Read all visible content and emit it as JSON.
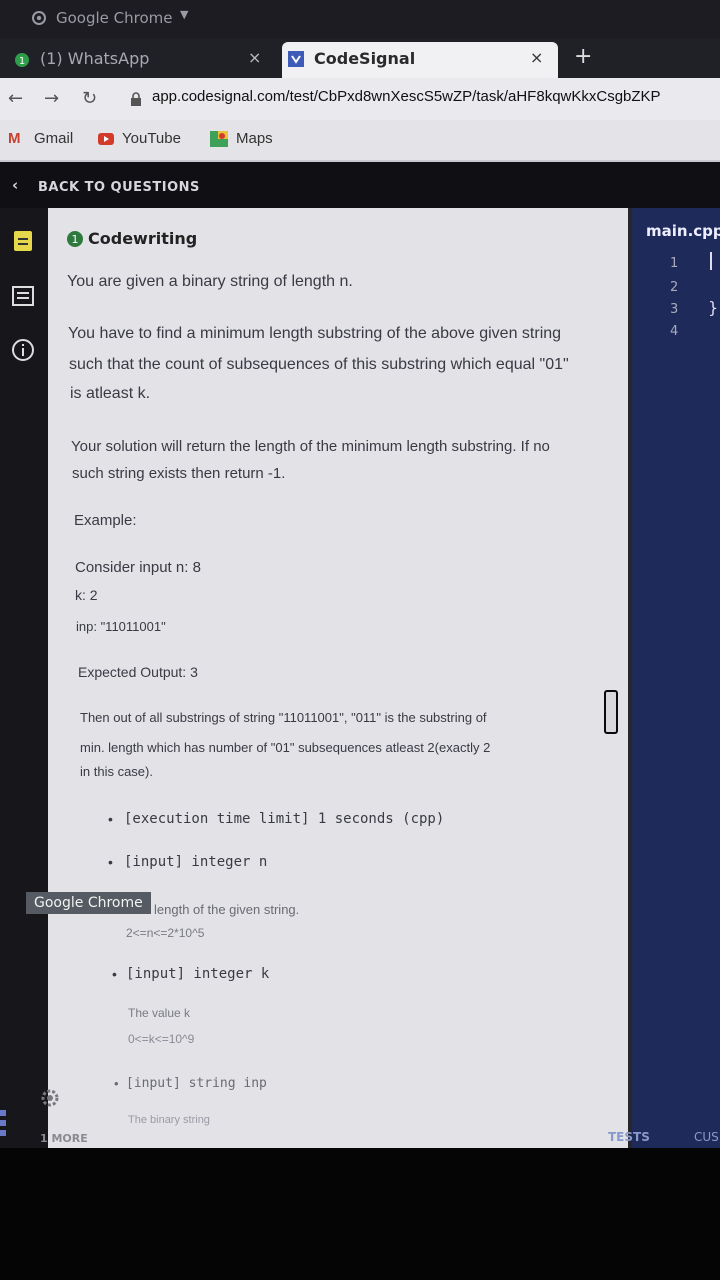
{
  "browser": {
    "window_title": "Google Chrome",
    "tabs": [
      {
        "label": "(1) WhatsApp",
        "close": "×"
      },
      {
        "label": "CodeSignal",
        "close": "×"
      }
    ],
    "new_tab": "+",
    "url": "app.codesignal.com/test/CbPxd8wnXescS5wZP/task/aHF8kqwKkxCsgbZKP",
    "bookmarks": [
      "Gmail",
      "YouTube",
      "Maps"
    ]
  },
  "app": {
    "back_label": "BACK TO QUESTIONS",
    "section_title": "Codewriting",
    "description": [
      "You are given a binary string of length n.",
      "You have to find a minimum length substring of the above given string",
      "such that the count of subsequences of this substring which equal \"01\"",
      "is atleast k.",
      "Your solution will return the length of the minimum length substring. If no",
      "such string exists then return -1."
    ],
    "example_label": "Example:",
    "example_lines": [
      "Consider input n: 8",
      "k: 2",
      "inp: \"11011001\""
    ],
    "expected_output": "Expected Output: 3",
    "explanation": [
      "Then out of all substrings of string \"11011001\", \"011\" is the substring of",
      "min. length which has number of \"01\" subsequences atleast 2(exactly 2",
      "in this case)."
    ],
    "constraints": [
      {
        "label": "[execution time limit] 1 seconds (cpp)"
      },
      {
        "label": "[input] integer n",
        "desc": "length of the given string.",
        "range": "2<=n<=2*10^5"
      },
      {
        "label": "[input] integer k",
        "desc": "The value k",
        "range": "0<=k<=10^9"
      },
      {
        "label": "[input] string inp",
        "desc": "The binary string"
      }
    ],
    "more_label": "1 MORE",
    "tooltip": "Google Chrome",
    "editor": {
      "filename": "main.cpp",
      "line_numbers": [
        "1",
        "2",
        "3",
        "4"
      ],
      "brace": "}",
      "tests_label": "TESTS",
      "custom_label": "CUS"
    }
  },
  "colors": {
    "accent": "#3e5bb8",
    "editor_bg": "#1e2a5a",
    "panel_bg": "#e2e2e7"
  }
}
